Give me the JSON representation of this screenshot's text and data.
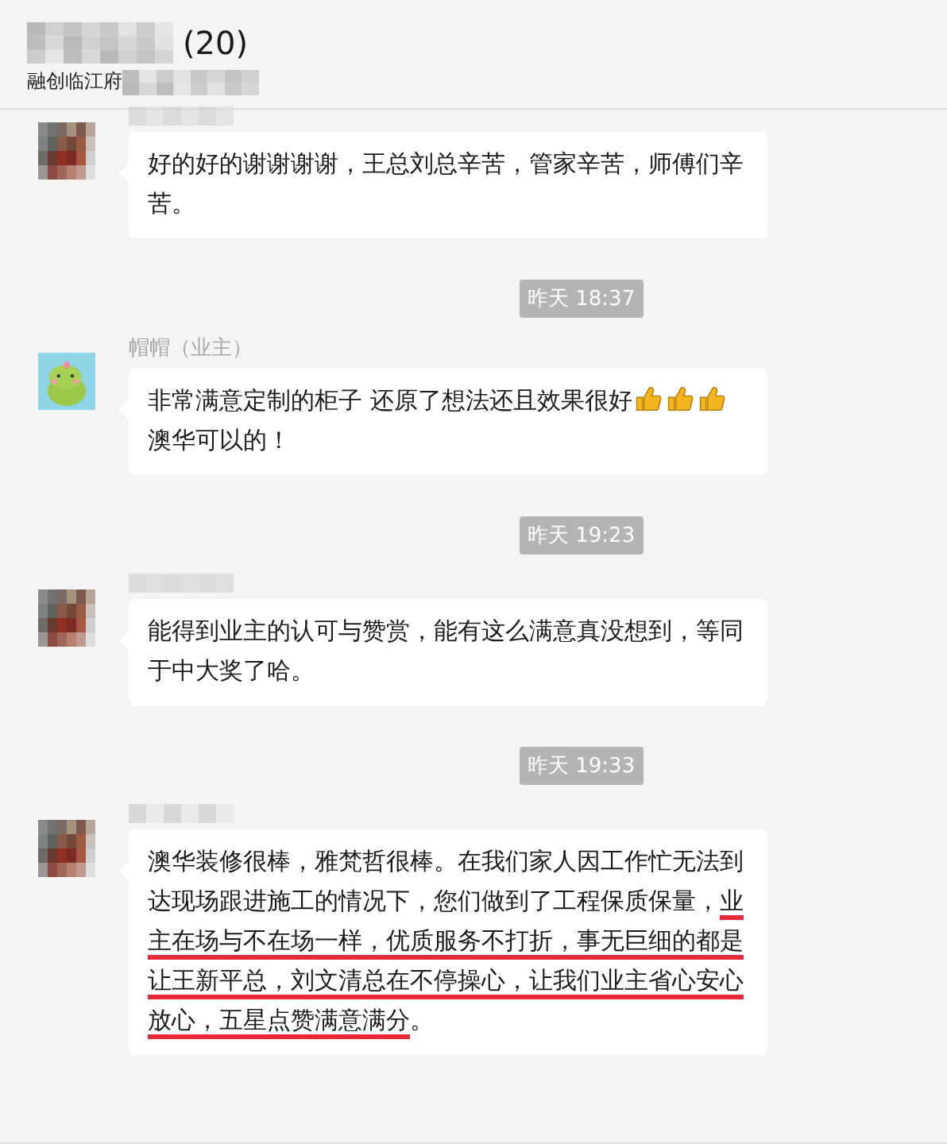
{
  "header": {
    "title": "(20)",
    "subtitle": "融创临江府"
  },
  "feed": [
    {
      "kind": "message",
      "avatar": {
        "kind": "mosaic"
      },
      "segments": [
        {
          "kind": "text",
          "text": "好的好的谢谢谢谢，王总刘总辛苦，管家辛苦，师傅们辛苦。"
        }
      ]
    },
    {
      "kind": "time",
      "text": "昨天 18:37"
    },
    {
      "kind": "message",
      "avatar": {
        "kind": "frog"
      },
      "sender": "帽帽（业主）",
      "segments": [
        {
          "kind": "text",
          "text": "非常满意定制的柜子 还原了想法还且效果很好"
        },
        {
          "kind": "thumbs"
        },
        {
          "kind": "thumbs"
        },
        {
          "kind": "thumbs"
        },
        {
          "kind": "text",
          "text": "澳华可以的！"
        }
      ]
    },
    {
      "kind": "time",
      "text": "昨天 19:23"
    },
    {
      "kind": "message",
      "avatar": {
        "kind": "mosaic"
      },
      "segments": [
        {
          "kind": "text",
          "text": "能得到业主的认可与赞赏，能有这么满意真没想到，等同于中大奖了哈。"
        }
      ]
    },
    {
      "kind": "time",
      "text": "昨天 19:33"
    },
    {
      "kind": "message",
      "avatar": {
        "kind": "mosaic"
      },
      "segments": [
        {
          "kind": "text",
          "text": "澳华装修很棒，雅梵哲很棒。在我们家人因工作忙无法到达现场跟进施工的情况下，您们做到了工程保质保量，",
          "underlined": false
        },
        {
          "kind": "text",
          "text": "业主在场与不在场一样，优质服务不打折，事无巨细的都是让王新平总，刘文清总在不停操心，让我们业主省心安心放心，五星点赞满意满分",
          "underlined": true
        },
        {
          "kind": "text",
          "text": "。",
          "underlined": false
        }
      ]
    }
  ]
}
